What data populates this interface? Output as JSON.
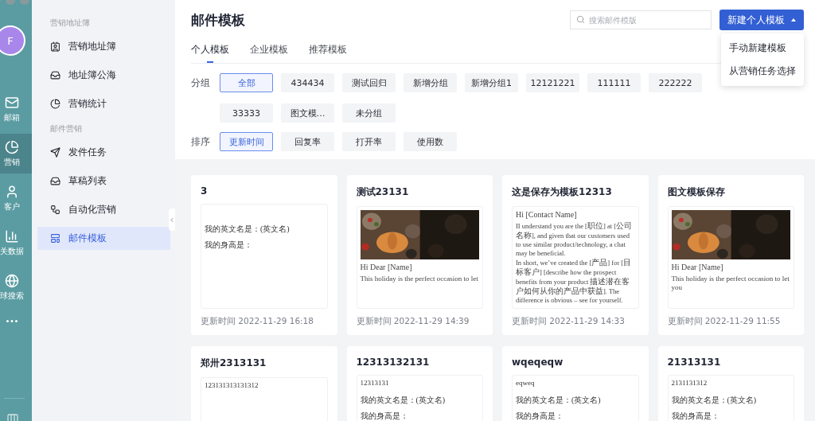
{
  "rail": {
    "avatar": "F",
    "items": [
      {
        "label": "邮箱",
        "selected": false
      },
      {
        "label": "营销",
        "selected": true
      },
      {
        "label": "客户",
        "selected": false
      },
      {
        "label": "关数据",
        "selected": false
      },
      {
        "label": "球搜索",
        "selected": false
      }
    ]
  },
  "sidebar": {
    "sections": [
      {
        "title": "营销地址簿",
        "items": [
          {
            "label": "营销地址簿",
            "selected": false
          },
          {
            "label": "地址簿公海",
            "selected": false
          },
          {
            "label": "营销统计",
            "selected": false
          }
        ]
      },
      {
        "title": "邮件营销",
        "items": [
          {
            "label": "发件任务",
            "selected": false
          },
          {
            "label": "草稿列表",
            "selected": false
          },
          {
            "label": "自动化营销",
            "selected": false
          },
          {
            "label": "邮件模板",
            "selected": true
          }
        ]
      }
    ]
  },
  "header": {
    "title": "邮件模板",
    "search": {
      "placeholder": "搜索邮件模版"
    },
    "new_button": "新建个人模板",
    "menu": [
      "手动新建模板",
      "从营销任务选择"
    ]
  },
  "tabs": [
    {
      "label": "个人模板",
      "selected": true
    },
    {
      "label": "企业模板",
      "selected": false
    },
    {
      "label": "推荐模板",
      "selected": false
    }
  ],
  "groups": {
    "label": "分组",
    "items": [
      {
        "label": "全部",
        "selected": true
      },
      {
        "label": "434434",
        "selected": false
      },
      {
        "label": "测试回归",
        "selected": false
      },
      {
        "label": "新增分组",
        "selected": false
      },
      {
        "label": "新增分组1",
        "selected": false
      },
      {
        "label": "12121221",
        "selected": false
      },
      {
        "label": "111111",
        "selected": false
      },
      {
        "label": "222222",
        "selected": false
      },
      {
        "label": "33333",
        "selected": false
      },
      {
        "label": "图文模…",
        "selected": false
      },
      {
        "label": "未分组",
        "selected": false
      }
    ]
  },
  "sort": {
    "label": "排序",
    "items": [
      {
        "label": "更新时间",
        "selected": true
      },
      {
        "label": "回复率",
        "selected": false
      },
      {
        "label": "打开率",
        "selected": false
      },
      {
        "label": "使用数",
        "selected": false
      }
    ]
  },
  "cards": [
    {
      "title": "3",
      "preview": {
        "kind": "text",
        "lines": [
          "我的英文名是：(英文名)",
          "我的身高是："
        ]
      },
      "updated": "更新时间 2022-11-29 16:18"
    },
    {
      "title": "测试23131",
      "preview": {
        "heading": "Hi Dear [Name]",
        "body": "This holiday is the perfect occasion to let"
      },
      "updated": "更新时间 2022-11-29 14:39"
    },
    {
      "title": "这是保存为模板12313",
      "preview": {
        "kind": "letter",
        "heading": "Hi [Contact Name]",
        "paragraphs": [
          "II understand you are the [职位] at [公司名称], and given that our customers used to use similar product/technology, a chat may be beneficial.",
          "In short, we’ve created the [产品] for [目标客户] [describe how the prospect benefits from your product 描述潜在客户如何从你的产品中获益]. The difference is obvious – see for yourself."
        ]
      },
      "updated": "更新时间 2022-11-29 14:33"
    },
    {
      "title": "图文模板保存",
      "preview": {
        "heading": "Hi Dear [Name]",
        "body": "This holiday is the perfect occasion to let you"
      },
      "updated": "更新时间 2022-11-29 11:55"
    },
    {
      "title": "郑卅2313131",
      "preview": {
        "kind": "text",
        "first": "123131313131312"
      }
    },
    {
      "title": "12313132131",
      "preview": {
        "kind": "text",
        "first": "12313131",
        "lines": [
          "我的英文名是：(英文名)",
          "我的身高是："
        ]
      }
    },
    {
      "title": "wqeqeqw",
      "preview": {
        "kind": "text",
        "first": "eqweq",
        "lines": [
          "我的英文名是：(英文名)",
          "我的身高是："
        ]
      }
    },
    {
      "title": "21313131",
      "preview": {
        "kind": "text",
        "first": "2131131312",
        "lines": [
          "我的英文名是：(英文名)",
          "我的身高是："
        ]
      }
    }
  ]
}
